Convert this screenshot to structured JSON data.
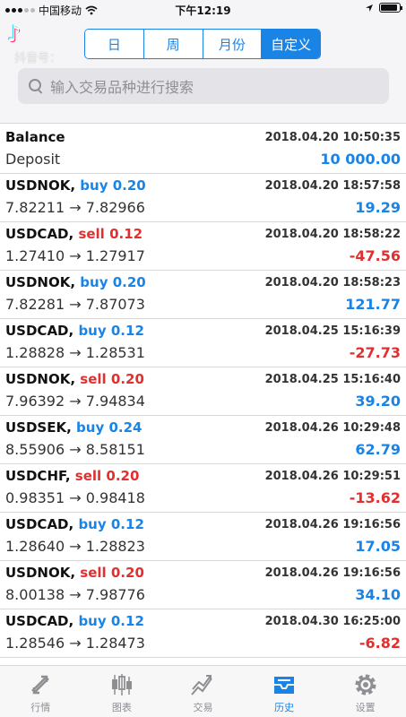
{
  "statusbar": {
    "carrier": "中国移动",
    "time": "下午12:19"
  },
  "watermark": {
    "text": "抖音号："
  },
  "segments": [
    {
      "label": "日",
      "active": false
    },
    {
      "label": "周",
      "active": false
    },
    {
      "label": "月份",
      "active": false
    },
    {
      "label": "自定义",
      "active": true
    }
  ],
  "search": {
    "placeholder": "输入交易品种进行搜索"
  },
  "deals": [
    {
      "symbol": "Balance",
      "side": "",
      "volume": "",
      "datetime": "2018.04.20 10:50:35",
      "prices": "Deposit",
      "profit": "10 000.00",
      "profit_sign": "pos"
    },
    {
      "symbol": "USDNOK,",
      "side": "buy",
      "volume": "0.20",
      "datetime": "2018.04.20 18:57:58",
      "prices": "7.82211 → 7.82966",
      "profit": "19.29",
      "profit_sign": "pos"
    },
    {
      "symbol": "USDCAD,",
      "side": "sell",
      "volume": "0.12",
      "datetime": "2018.04.20 18:58:22",
      "prices": "1.27410 → 1.27917",
      "profit": "-47.56",
      "profit_sign": "neg"
    },
    {
      "symbol": "USDNOK,",
      "side": "buy",
      "volume": "0.20",
      "datetime": "2018.04.20 18:58:23",
      "prices": "7.82281 → 7.87073",
      "profit": "121.77",
      "profit_sign": "pos"
    },
    {
      "symbol": "USDCAD,",
      "side": "buy",
      "volume": "0.12",
      "datetime": "2018.04.25 15:16:39",
      "prices": "1.28828 → 1.28531",
      "profit": "-27.73",
      "profit_sign": "neg"
    },
    {
      "symbol": "USDNOK,",
      "side": "sell",
      "volume": "0.20",
      "datetime": "2018.04.25 15:16:40",
      "prices": "7.96392 → 7.94834",
      "profit": "39.20",
      "profit_sign": "pos"
    },
    {
      "symbol": "USDSEK,",
      "side": "buy",
      "volume": "0.24",
      "datetime": "2018.04.26 10:29:48",
      "prices": "8.55906 → 8.58151",
      "profit": "62.79",
      "profit_sign": "pos"
    },
    {
      "symbol": "USDCHF,",
      "side": "sell",
      "volume": "0.20",
      "datetime": "2018.04.26 10:29:51",
      "prices": "0.98351 → 0.98418",
      "profit": "-13.62",
      "profit_sign": "neg"
    },
    {
      "symbol": "USDCAD,",
      "side": "buy",
      "volume": "0.12",
      "datetime": "2018.04.26 19:16:56",
      "prices": "1.28640 → 1.28823",
      "profit": "17.05",
      "profit_sign": "pos"
    },
    {
      "symbol": "USDNOK,",
      "side": "sell",
      "volume": "0.20",
      "datetime": "2018.04.26 19:16:56",
      "prices": "8.00138 → 7.98776",
      "profit": "34.10",
      "profit_sign": "pos"
    },
    {
      "symbol": "USDCAD,",
      "side": "buy",
      "volume": "0.12",
      "datetime": "2018.04.30 16:25:00",
      "prices": "1.28546 → 1.28473",
      "profit": "-6.82",
      "profit_sign": "neg"
    }
  ],
  "tabs": [
    {
      "label": "行情",
      "icon": "quotes-icon",
      "active": false
    },
    {
      "label": "图表",
      "icon": "chart-icon",
      "active": false
    },
    {
      "label": "交易",
      "icon": "trade-icon",
      "active": false
    },
    {
      "label": "历史",
      "icon": "history-icon",
      "active": true
    },
    {
      "label": "设置",
      "icon": "settings-icon",
      "active": false
    }
  ],
  "colors": {
    "accent": "#1a84e6",
    "negative": "#e0302f"
  }
}
